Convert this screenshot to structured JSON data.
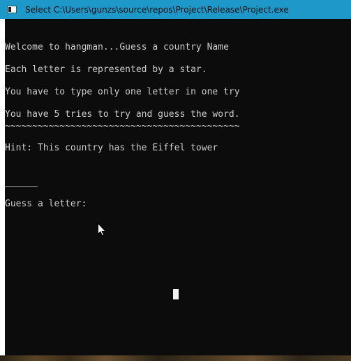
{
  "window": {
    "title": "Select C:\\Users\\gunzs\\source\\repos\\Project\\Release\\Project.exe",
    "title_icon": "console-app-icon"
  },
  "console": {
    "lines": [
      "Welcome to hangman...Guess a country Name",
      "Each letter is represented by a star.",
      "You have to type only one letter in one try",
      "You have 5 tries to try and guess the word.",
      "~~~~~~~~~~~~~~~~~~~~~~~~~~~~~~~~~~~~~~~~~~~",
      "Hint: This country has the Eiffel tower",
      "______",
      "Guess a letter:"
    ],
    "text_color": "#cccccc",
    "background": "#0c0c0c"
  },
  "colors": {
    "titlebar": "#1d98c9",
    "cursor": "#f2f2f2"
  }
}
